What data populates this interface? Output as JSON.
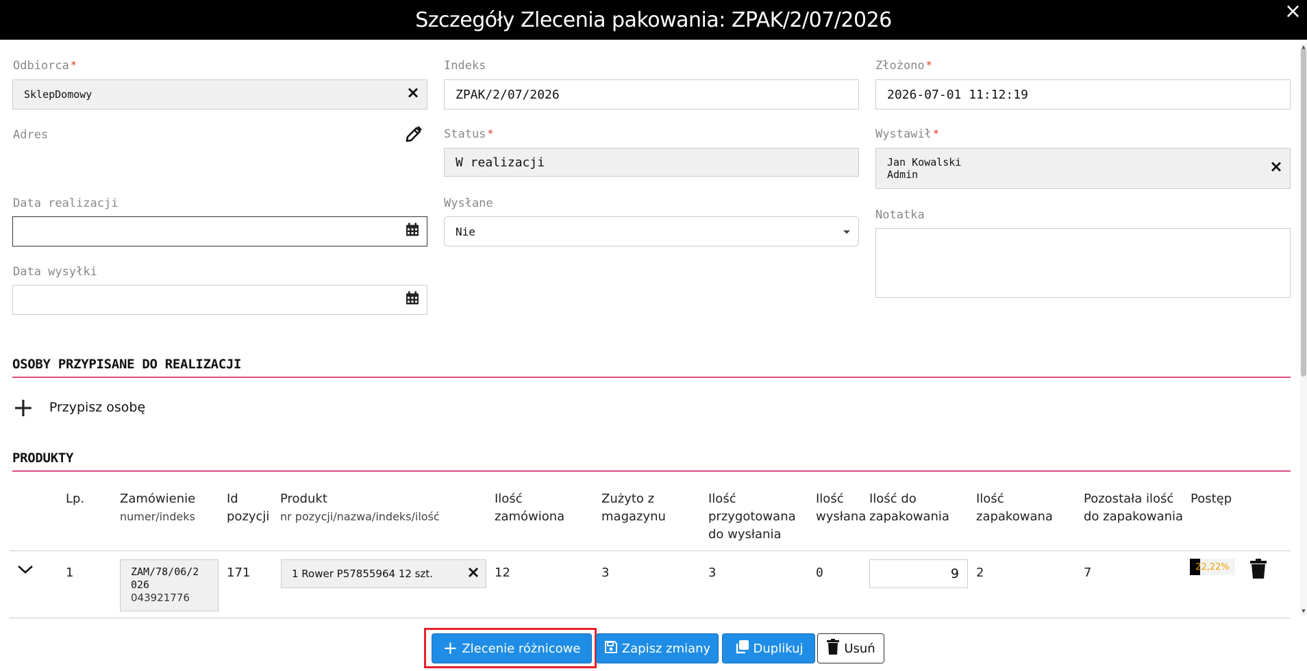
{
  "header": {
    "title": "Szczegóły Zlecenia pakowania: ZPAK/2/07/2026",
    "close": "×"
  },
  "form": {
    "odbiorca": {
      "label": "Odbiorca",
      "value": "SklepDomowy"
    },
    "adres": {
      "label": "Adres"
    },
    "data_realizacji": {
      "label": "Data realizacji",
      "value": ""
    },
    "data_wysylki": {
      "label": "Data wysyłki",
      "value": ""
    },
    "indeks": {
      "label": "Indeks",
      "value": "ZPAK/2/07/2026"
    },
    "status": {
      "label": "Status",
      "value": "W realizacji"
    },
    "wyslane": {
      "label": "Wysłane",
      "value": "Nie"
    },
    "zlozono": {
      "label": "Złożono",
      "value": "2026-07-01 11:12:19"
    },
    "wystawil": {
      "label": "Wystawił",
      "name": "Jan Kowalski",
      "role": "Admin"
    },
    "notatka": {
      "label": "Notatka",
      "value": ""
    },
    "required_mark": "*"
  },
  "assigned": {
    "title": "OSOBY PRZYPISANE DO REALIZACJI",
    "add_label": "Przypisz osobę"
  },
  "products": {
    "title": "PRODUKTY",
    "columns": {
      "lp": "Lp.",
      "order": "Zamówienie",
      "order_sub": "numer/indeks",
      "id1": "Id",
      "id2": "pozycji",
      "product": "Produkt",
      "product_sub": "nr pozycji/nazwa/indeks/ilość",
      "ordered1": "Ilość",
      "ordered2": "zamówiona",
      "used1": "Zużyto z",
      "used2": "magazynu",
      "prepared1": "Ilość",
      "prepared2": "przygotowana",
      "prepared3": "do wysłania",
      "sent1": "Ilość",
      "sent2": "wysłana",
      "topack1": "Ilość do",
      "topack2": "zapakowania",
      "packed1": "Ilość",
      "packed2": "zapakowana",
      "remaining1": "Pozostała ilość",
      "remaining2": "do zapakowania",
      "progress": "Postęp"
    },
    "rows": [
      {
        "lp": "1",
        "order_number_1": "ZAM/78/06/2",
        "order_number_2": "026",
        "order_index": "043921776",
        "position_id": "171",
        "product": "1 Rower P57855964 12 szt.",
        "ordered": "12",
        "used": "3",
        "prepared": "3",
        "sent": "0",
        "to_pack": "9",
        "packed": "2",
        "remaining": "7",
        "progress_label": "22,22%",
        "progress_value": 0.2222
      }
    ]
  },
  "buttons": {
    "difference_order": "Zlecenie różnicowe",
    "save": "Zapisz zmiany",
    "duplicate": "Duplikuj",
    "delete": "Usuń"
  }
}
